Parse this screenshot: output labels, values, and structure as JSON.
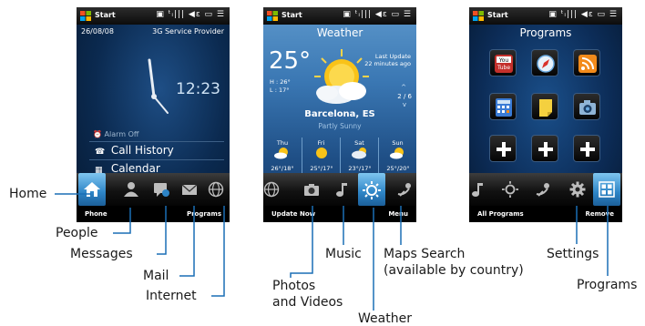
{
  "status_bar": {
    "start_label": "Start",
    "icons_text": "▣ ᵗᵢ||| ◀ε ▭ ☰"
  },
  "home": {
    "date": "26/08/08",
    "carrier": "3G Service Provider",
    "time": "12:23",
    "alarm": "Alarm Off",
    "alarm_icon": "⏰",
    "call_history": "Call History",
    "call_icon": "☎",
    "calendar": "Calendar",
    "calendar_icon": "▦",
    "left_softkey": "Phone",
    "right_softkey": "Programs"
  },
  "weather": {
    "title": "Weather",
    "temp": "25°",
    "high": "H : 26°",
    "low": "L : 17°",
    "last_update_label": "Last Update",
    "last_update_value": "22 minutes ago",
    "page_indicator": "2 / 6",
    "arrow_up": "^",
    "arrow_down": "v",
    "city": "Barcelona, ES",
    "condition": "Partly Sunny",
    "forecast": [
      {
        "day": "Thu",
        "temps": "26°/18°"
      },
      {
        "day": "Fri",
        "temps": "25°/17°"
      },
      {
        "day": "Sat",
        "temps": "23°/17°"
      },
      {
        "day": "Sun",
        "temps": "25°/20°"
      }
    ],
    "left_softkey": "Update Now",
    "right_softkey": "Menu"
  },
  "programs": {
    "title": "Programs",
    "youtube_label": "You\nTube",
    "left_softkey": "All Programs",
    "right_softkey": "Remove"
  },
  "callouts": {
    "home": "Home",
    "people": "People",
    "messages": "Messages",
    "mail": "Mail",
    "internet": "Internet",
    "photos_line1": "Photos",
    "photos_line2": "and Videos",
    "music": "Music",
    "maps_line1": "Maps Search",
    "maps_line2": "(available by country)",
    "weather": "Weather",
    "settings": "Settings",
    "programs": "Programs"
  },
  "colors": {
    "active_tab": "#2d84c6",
    "weather_sky": "#3a77b3",
    "home_bg": "#0b2a50",
    "callout_line": "#1a6fb5"
  }
}
